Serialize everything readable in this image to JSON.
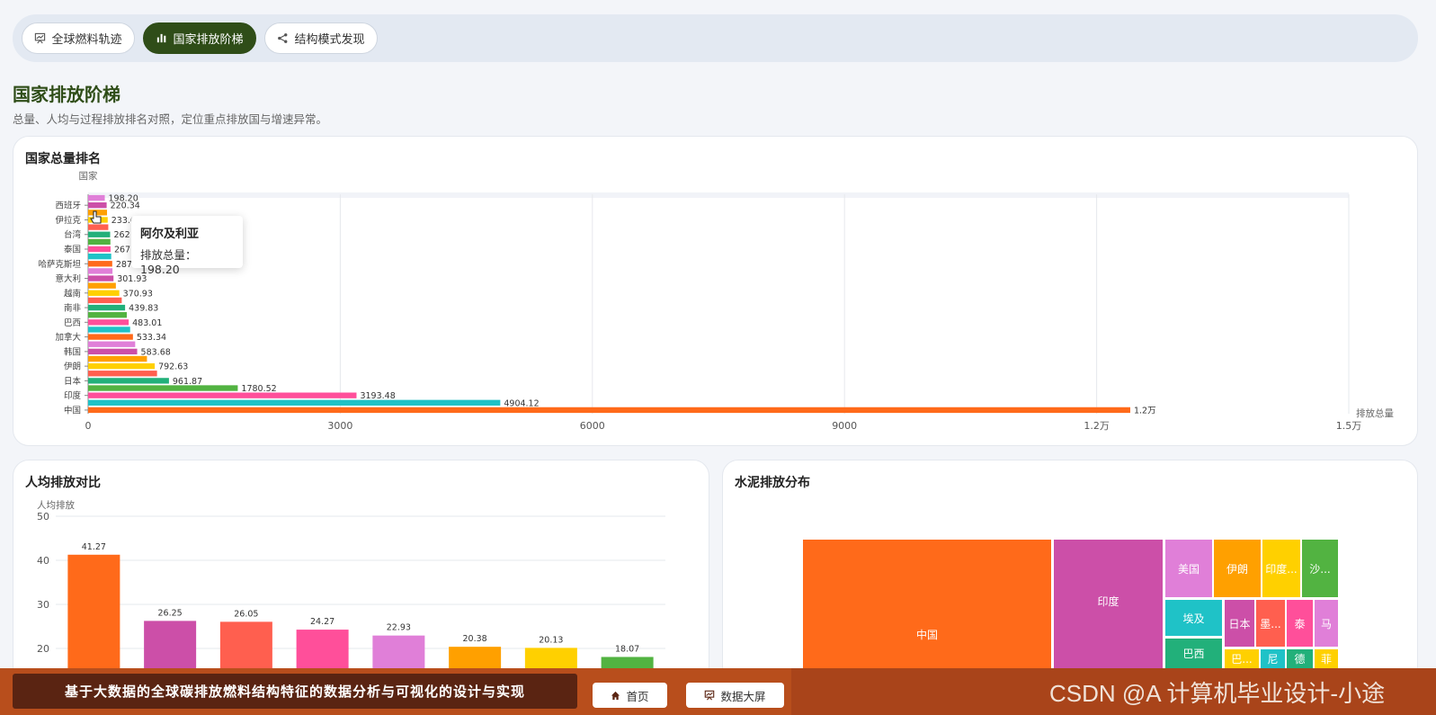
{
  "tabs": [
    {
      "label": "全球燃料轨迹",
      "icon": "trend-chart-icon",
      "active": false
    },
    {
      "label": "国家排放阶梯",
      "icon": "bar-chart-icon",
      "active": true
    },
    {
      "label": "结构模式发现",
      "icon": "share-nodes-icon",
      "active": false
    }
  ],
  "page": {
    "title": "国家排放阶梯",
    "description": "总量、人均与过程排放排名对照，定位重点排放国与增速异常。"
  },
  "cards": {
    "total": {
      "title": "国家总量排名"
    },
    "per_capita": {
      "title": "人均排放对比"
    },
    "cement": {
      "title": "水泥排放分布"
    }
  },
  "tooltip": {
    "title": "阿尔及利亚",
    "label": "排放总量：198.20"
  },
  "footer": {
    "title": "基于大数据的全球碳排放燃料结构特征的数据分析与可视化的设计与实现",
    "home_label": "首页",
    "bigscreen_label": "数据大屏",
    "watermark": "CSDN @A 计算机毕业设计-小途"
  },
  "colors": {
    "accent": "#2f4d18",
    "footer": "#b84e1c",
    "bars": [
      "#52b341",
      "#ffd000",
      "#e07fd8",
      "#ff4f9a",
      "#ff5f4f",
      "#cc4fa8",
      "#1fc2c7",
      "#22b07a",
      "#ffa000",
      "#ff6a1a"
    ]
  },
  "chart_data": [
    {
      "type": "bar",
      "orientation": "horizontal",
      "title": "国家总量排名",
      "ylabel": "国家",
      "xlabel": "排放总量",
      "xlim": [
        0,
        15000
      ],
      "x_ticks": [
        "0",
        "3000",
        "6000",
        "9000",
        "1.2万",
        "1.5万"
      ],
      "y_tick_labels": [
        "中国",
        "印度",
        "日本",
        "伊朗",
        "韩国",
        "加拿大",
        "巴西",
        "南非",
        "越南",
        "意大利",
        "哈萨克斯坦",
        "泰国",
        "台湾",
        "伊拉克",
        "西班牙"
      ],
      "values": [
        12400,
        4904.12,
        3193.48,
        1780.52,
        961.87,
        820,
        792.63,
        700,
        583.68,
        560,
        533.34,
        500,
        483.01,
        460,
        439.83,
        400,
        370.93,
        330,
        301.93,
        290,
        287,
        275,
        267,
        265,
        262,
        240,
        233,
        225,
        220.34,
        198.2
      ],
      "data_labels": [
        "1.2万",
        "4904.12",
        "3193.48",
        "1780.52",
        "961.87",
        "",
        "792.63",
        "",
        "583.68",
        "",
        "533.34",
        "",
        "483.01",
        "",
        "439.83",
        "",
        "370.93",
        "",
        "301.93",
        "",
        "287",
        "",
        "267",
        "",
        "262",
        "",
        "233.6",
        "",
        "220.34",
        "198.20"
      ],
      "grid": true
    },
    {
      "type": "bar",
      "title": "人均排放对比",
      "ylabel": "人均排放",
      "ylim": [
        0,
        50
      ],
      "y_ticks": [
        "20",
        "30",
        "40",
        "50"
      ],
      "values": [
        41.27,
        26.25,
        26.05,
        24.27,
        22.93,
        20.38,
        20.13,
        18.07
      ],
      "data_labels": [
        "41.27",
        "26.25",
        "26.05",
        "24.27",
        "22.93",
        "20.38",
        "20.13",
        "18.07"
      ],
      "grid": true
    },
    {
      "type": "treemap",
      "title": "水泥排放分布",
      "labels": [
        "中国",
        "印度",
        "美国",
        "伊朗",
        "印度...",
        "沙...",
        "埃及",
        "日本",
        "墨...",
        "泰",
        "马",
        "巴西",
        "巴...",
        "尼",
        "德",
        "菲"
      ]
    }
  ]
}
